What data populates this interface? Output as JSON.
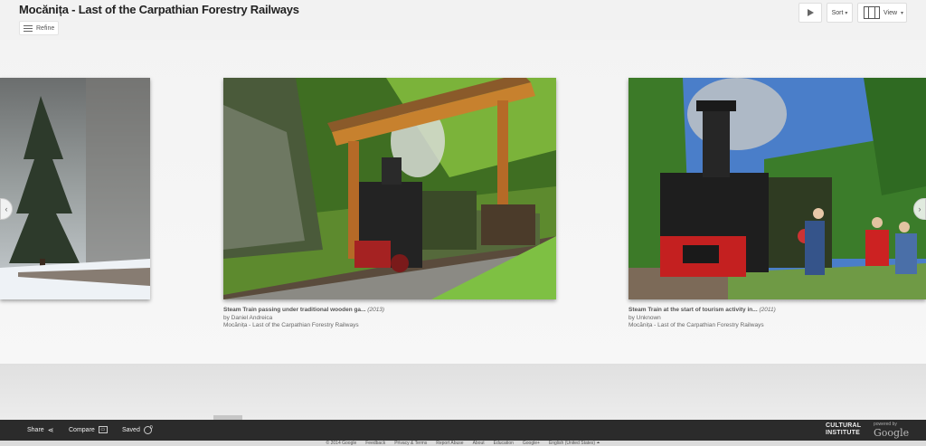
{
  "header": {
    "title": "Mocănița - Last of the Carpathian Forestry Railways",
    "refine_label": "Refine",
    "sort_label": "Sort",
    "view_label": "View"
  },
  "items": [
    {
      "title": "Steam Train passing under traditional wooden ga...",
      "year": "(2013)",
      "byline": "by Daniel Andreica",
      "collection": "Mocănița - Last of the Carpathian Forestry Railways"
    },
    {
      "title": "Steam Train at the start of tourism activity in...",
      "year": "(2011)",
      "byline": "by Unknown",
      "collection": "Mocănița - Last of the Carpathian Forestry Railways"
    }
  ],
  "bottom_bar": {
    "share_label": "Share",
    "compare_label": "Compare",
    "saved_label": "Saved",
    "saved_count": "0",
    "logo_line1": "CULTURAL",
    "logo_line2": "INSTITUTE",
    "powered_by": "powered by",
    "google": "Google"
  },
  "footer": {
    "links": [
      "© 2014 Google",
      "Feedback",
      "Privacy & Terms",
      "Report Abuse",
      "About",
      "Education",
      "Google+",
      "English (United States) ⏶"
    ]
  },
  "colors": {
    "bottom_bar_bg": "#2b2b2b",
    "page_bg": "#f2f2f2"
  }
}
